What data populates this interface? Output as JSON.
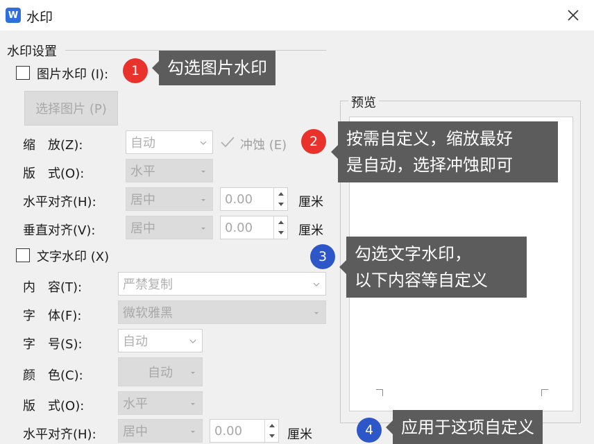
{
  "window": {
    "title": "水印",
    "app_icon": "W",
    "close_icon": "close-icon"
  },
  "colors": {
    "badge_red": "#e8322b",
    "badge_blue": "#2d56c8",
    "callout_bg": "#5c5c5c"
  },
  "watermark_settings": {
    "group_label": "水印设置",
    "image_watermark": {
      "label": "图片水印 (I):",
      "checked": false,
      "select_image_button": "选择图片 (P)",
      "scale_label": "缩　放(Z):",
      "scale_value": "自动",
      "washout_label": "冲蚀 (E)",
      "washout_checked": true,
      "layout_label": "版　式(O):",
      "layout_value": "水平",
      "h_align_label": "水平对齐(H):",
      "h_align_value": "居中",
      "h_offset": "0.00",
      "h_unit": "厘米",
      "v_align_label": "垂直对齐(V):",
      "v_align_value": "居中",
      "v_offset": "0.00",
      "v_unit": "厘米"
    },
    "text_watermark": {
      "label": "文字水印 (X)",
      "checked": false,
      "content_label": "内　容(T):",
      "content_value": "严禁复制",
      "font_label": "字　体(F):",
      "font_value": "微软雅黑",
      "size_label": "字　号(S):",
      "size_value": "自动",
      "color_label": "颜　色(C):",
      "color_value": "自动",
      "layout_label": "版　式(O):",
      "layout_value": "水平",
      "h_align_label": "水平对齐(H):",
      "h_align_value": "居中",
      "h_offset": "0.00",
      "h_unit": "厘米"
    }
  },
  "preview": {
    "label": "预览"
  },
  "annotations": [
    {
      "number": "1",
      "text": "勾选图片水印"
    },
    {
      "number": "2",
      "text": "按需自定义，缩放最好\n是自动，选择冲蚀即可"
    },
    {
      "number": "3",
      "text": "勾选文字水印，\n以下内容等自定义"
    },
    {
      "number": "4",
      "text": "应用于这项自定义"
    }
  ]
}
